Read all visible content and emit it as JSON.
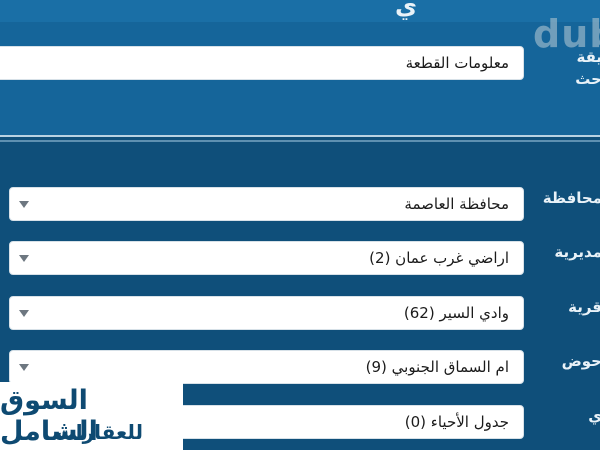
{
  "header": {
    "title_fragment": "ي",
    "watermark": "dub"
  },
  "search": {
    "label_line1": "يقة",
    "label_line2": "حث",
    "value": "معلومات القطعة"
  },
  "filters": [
    {
      "label": "محافظة",
      "value": "محافظة العاصمة"
    },
    {
      "label": "مديرية",
      "value": "اراضي غرب عمان (2)"
    },
    {
      "label": "قرية",
      "value": "وادي السير (62)"
    },
    {
      "label": "حوض",
      "value": "ام السماق الجنوبي (9)"
    },
    {
      "label": "ي",
      "value": "جدول الأحياء (0)"
    }
  ],
  "brand": {
    "line1": "السوق الشامل",
    "line2": "للعقارات"
  },
  "colors": {
    "background": "#0f4f7a",
    "panel": "#15659a",
    "brand_text": "#0e4a72"
  }
}
